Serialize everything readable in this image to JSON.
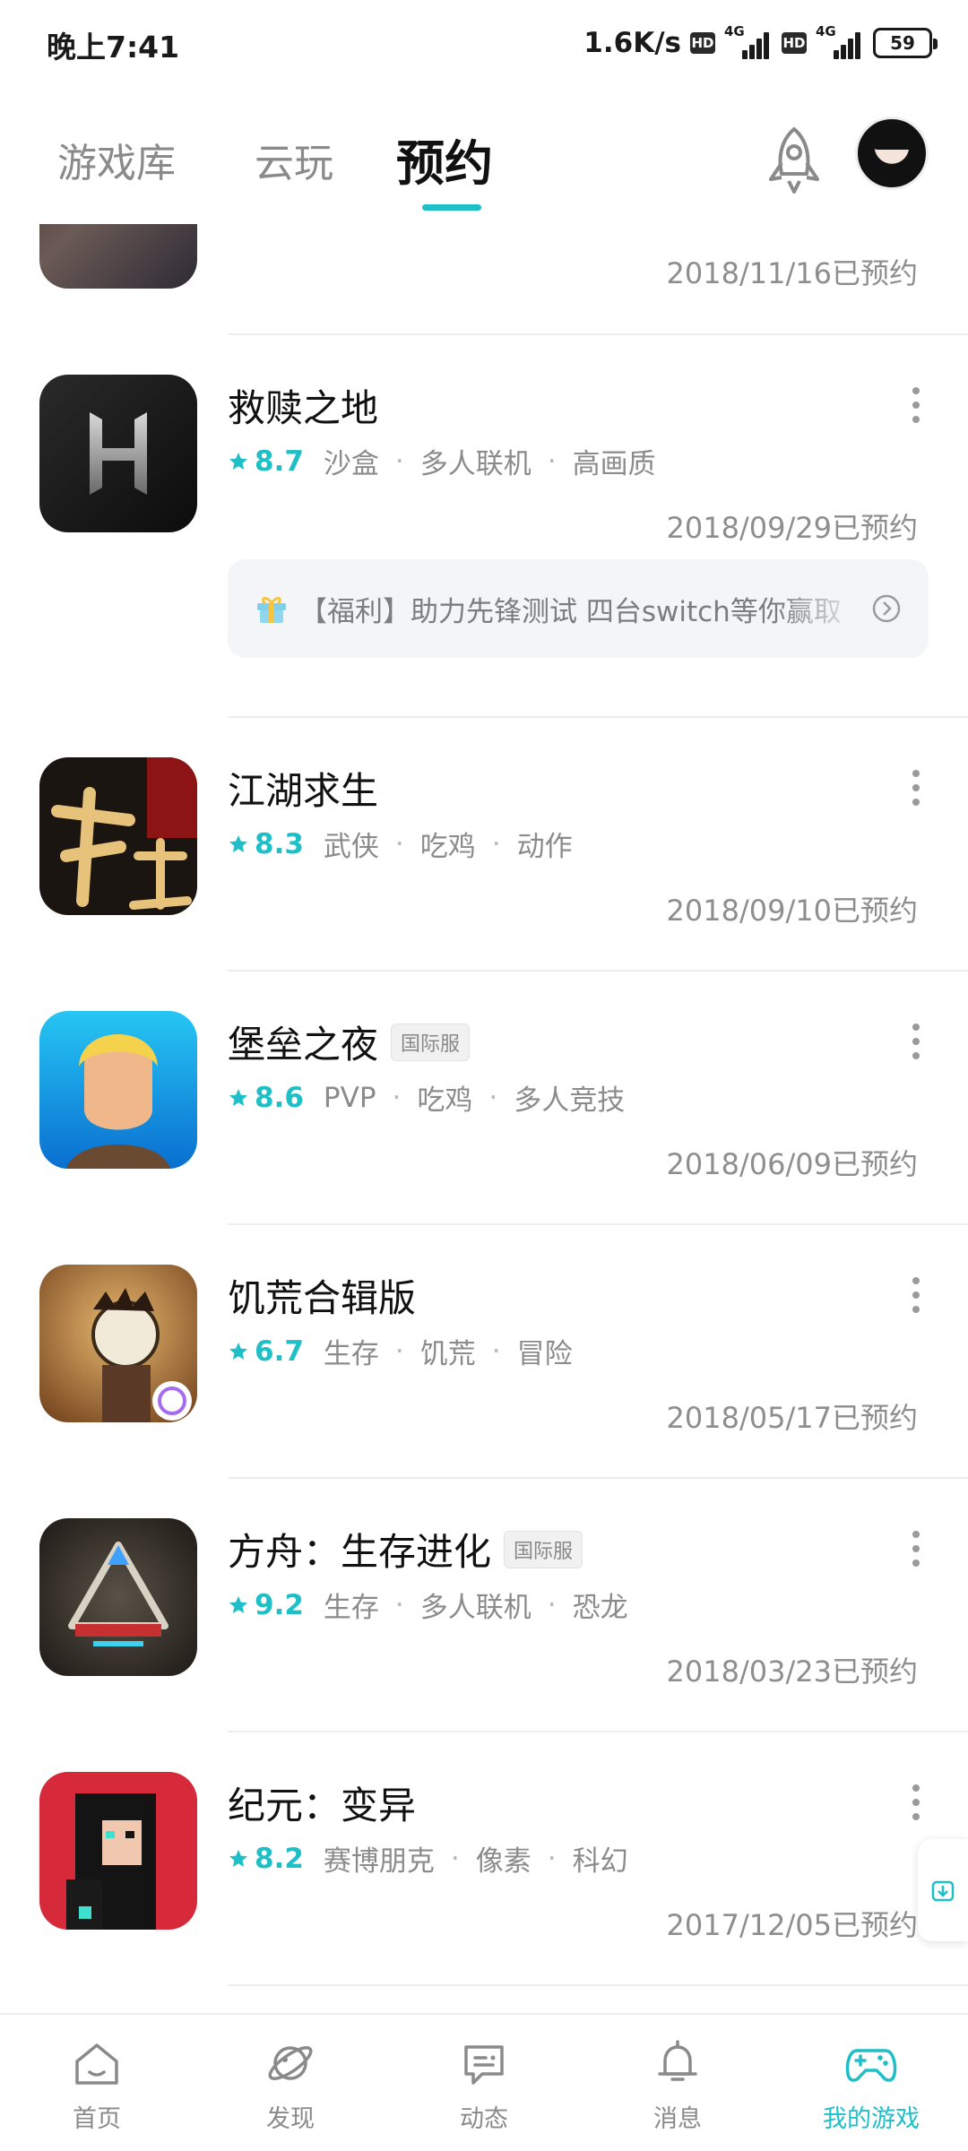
{
  "status_bar": {
    "time": "晚上7:41",
    "net_speed": "1.6K/s",
    "hd": "HD",
    "signal_gen": "4G",
    "battery": "59"
  },
  "top_tabs": [
    {
      "label": "游戏库",
      "active": false
    },
    {
      "label": "云玩",
      "active": false
    },
    {
      "label": "预约",
      "active": true
    }
  ],
  "partial_item": {
    "date": "2018/11/16已预约"
  },
  "games": [
    {
      "name": "救赎之地",
      "badge": "",
      "rating": "8.7",
      "tags": [
        "沙盒",
        "多人联机",
        "高画质"
      ],
      "date": "2018/09/29已预约",
      "promo": "【福利】助力先锋测试 四台switch等你赢取"
    },
    {
      "name": "江湖求生",
      "badge": "",
      "rating": "8.3",
      "tags": [
        "武侠",
        "吃鸡",
        "动作"
      ],
      "date": "2018/09/10已预约"
    },
    {
      "name": "堡垒之夜",
      "badge": "国际服",
      "rating": "8.6",
      "tags": [
        "PVP",
        "吃鸡",
        "多人竞技"
      ],
      "date": "2018/06/09已预约"
    },
    {
      "name": "饥荒合辑版",
      "badge": "",
      "rating": "6.7",
      "tags": [
        "生存",
        "饥荒",
        "冒险"
      ],
      "date": "2018/05/17已预约"
    },
    {
      "name": "方舟：生存进化",
      "badge": "国际服",
      "rating": "9.2",
      "tags": [
        "生存",
        "多人联机",
        "恐龙"
      ],
      "date": "2018/03/23已预约"
    },
    {
      "name": "纪元：变异",
      "badge": "",
      "rating": "8.2",
      "tags": [
        "赛博朋克",
        "像素",
        "科幻"
      ],
      "date": "2017/12/05已预约"
    }
  ],
  "bottom_nav": [
    {
      "label": "首页",
      "icon": "home-icon",
      "active": false
    },
    {
      "label": "发现",
      "icon": "planet-icon",
      "active": false
    },
    {
      "label": "动态",
      "icon": "chat-icon",
      "active": false
    },
    {
      "label": "消息",
      "icon": "bell-icon",
      "active": false
    },
    {
      "label": "我的游戏",
      "icon": "gamepad-icon",
      "active": true
    }
  ],
  "colors": {
    "accent": "#1fbfc7",
    "text_secondary": "#8b8b8b"
  }
}
